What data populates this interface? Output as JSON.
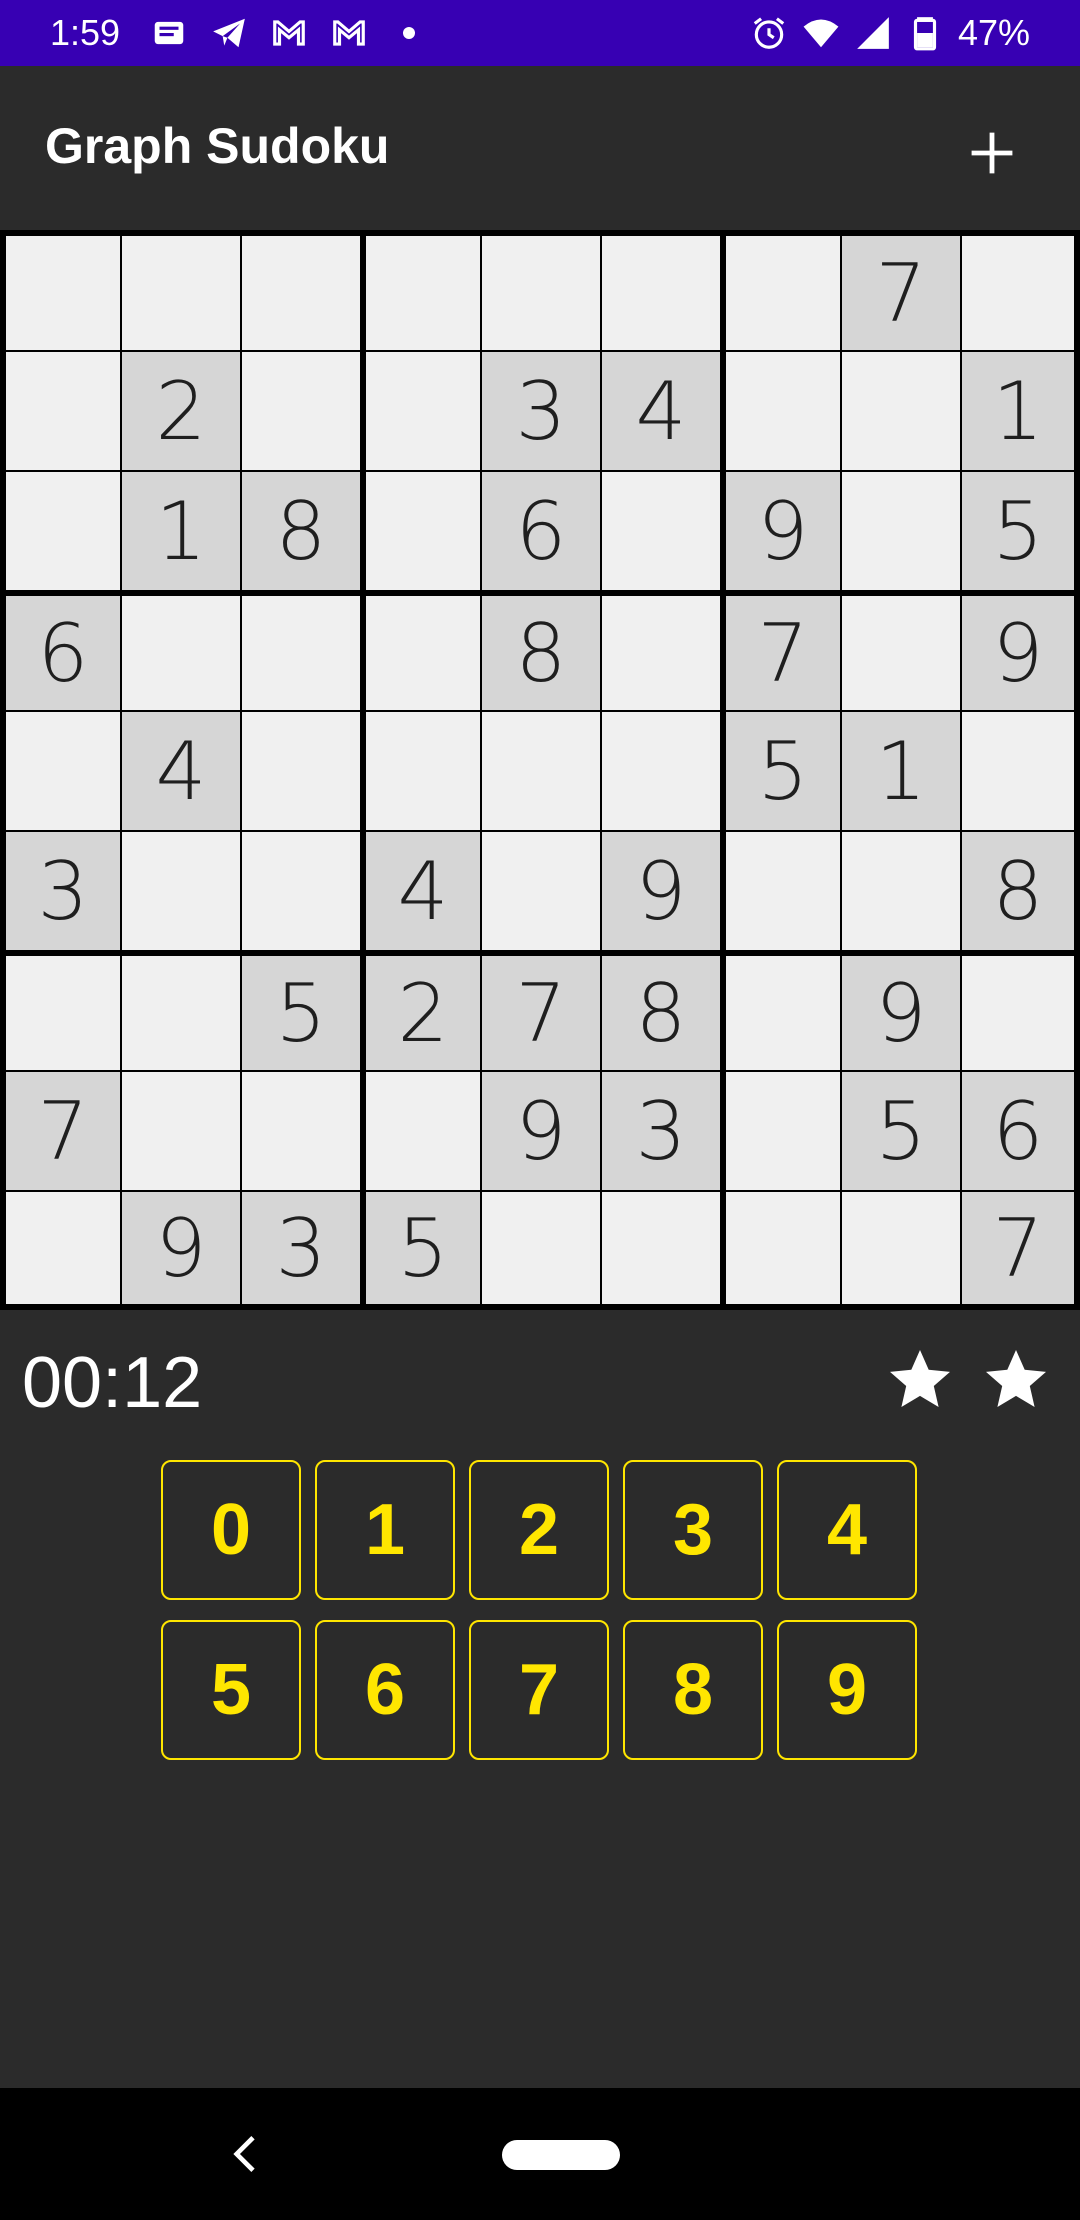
{
  "status_bar": {
    "time": "1:59",
    "battery_percent": "47%",
    "left_icons": [
      "notes-icon",
      "telegram-icon",
      "gmail-icon",
      "gmail-icon",
      "dot-icon"
    ],
    "right_icons": [
      "alarm-icon",
      "wifi-icon",
      "signal-icon",
      "battery-icon"
    ],
    "color": "#3700b3"
  },
  "app_bar": {
    "title": "Graph Sudoku",
    "action_icon": "plus-icon"
  },
  "board": {
    "rows": [
      [
        "",
        "",
        "",
        "",
        "",
        "",
        "",
        "7",
        ""
      ],
      [
        "",
        "2",
        "",
        "",
        "3",
        "4",
        "",
        "",
        "1"
      ],
      [
        "",
        "1",
        "8",
        "",
        "6",
        "",
        "9",
        "",
        "5"
      ],
      [
        "6",
        "",
        "",
        "",
        "8",
        "",
        "7",
        "",
        "9"
      ],
      [
        "",
        "4",
        "",
        "",
        "",
        "",
        "5",
        "1",
        ""
      ],
      [
        "3",
        "",
        "",
        "4",
        "",
        "9",
        "",
        "",
        "8"
      ],
      [
        "",
        "",
        "5",
        "2",
        "7",
        "8",
        "",
        "9",
        ""
      ],
      [
        "7",
        "",
        "",
        "",
        "9",
        "3",
        "",
        "5",
        "6"
      ],
      [
        "",
        "9",
        "3",
        "5",
        "",
        "",
        "",
        "",
        "7"
      ]
    ],
    "given_color": "#d6d6d6",
    "empty_color": "#f0f0f0"
  },
  "timer": "00:12",
  "stars": [
    "star-icon",
    "star-icon"
  ],
  "keypad": {
    "keys": [
      "0",
      "1",
      "2",
      "3",
      "4",
      "5",
      "6",
      "7",
      "8",
      "9"
    ],
    "accent": "#ffe600"
  },
  "nav_bar": {
    "back_icon": "back-chevron-icon",
    "home_icon": "home-pill-icon"
  }
}
